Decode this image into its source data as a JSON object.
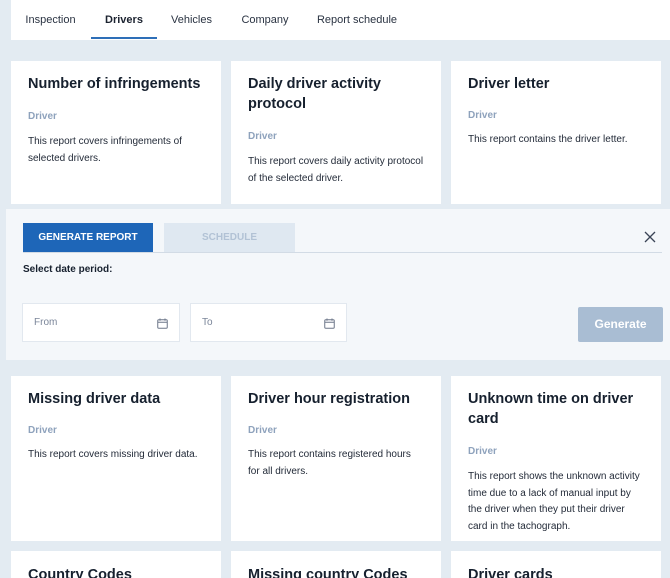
{
  "tabs": [
    {
      "label": "Inspection"
    },
    {
      "label": "Drivers"
    },
    {
      "label": "Vehicles"
    },
    {
      "label": "Company"
    },
    {
      "label": "Report schedule"
    }
  ],
  "active_tab": "Drivers",
  "cards_row1": [
    {
      "title": "Number of infringements",
      "category": "Driver",
      "description": "This report covers infringements of selected drivers."
    },
    {
      "title": "Daily driver activity protocol",
      "category": "Driver",
      "description": "This report covers daily activity protocol of the selected driver."
    },
    {
      "title": "Driver letter",
      "category": "Driver",
      "description": "This report contains the driver letter."
    }
  ],
  "panel": {
    "generate_report_label": "GENERATE REPORT",
    "schedule_label": "SCHEDULE",
    "select_label": "Select date period:",
    "from_placeholder": "From",
    "to_placeholder": "To",
    "generate_label": "Generate"
  },
  "cards_row2": [
    {
      "title": "Missing driver data",
      "category": "Driver",
      "description": "This report covers missing driver data."
    },
    {
      "title": "Driver hour registration",
      "category": "Driver",
      "description": "This report contains registered hours for all drivers."
    },
    {
      "title": "Unknown time on driver card",
      "category": "Driver",
      "description": "This report shows the unknown activity time due to a lack of manual input by the driver when they put their driver card in the tachograph."
    }
  ],
  "cards_row3": [
    {
      "title": "Country Codes"
    },
    {
      "title": "Missing country Codes"
    },
    {
      "title": "Driver cards"
    }
  ],
  "colors": {
    "accent": "#1e66b8",
    "category": "#8ea2bc",
    "background": "#e3ebf2"
  },
  "icons": [
    "close-icon",
    "calendar-icon"
  ]
}
